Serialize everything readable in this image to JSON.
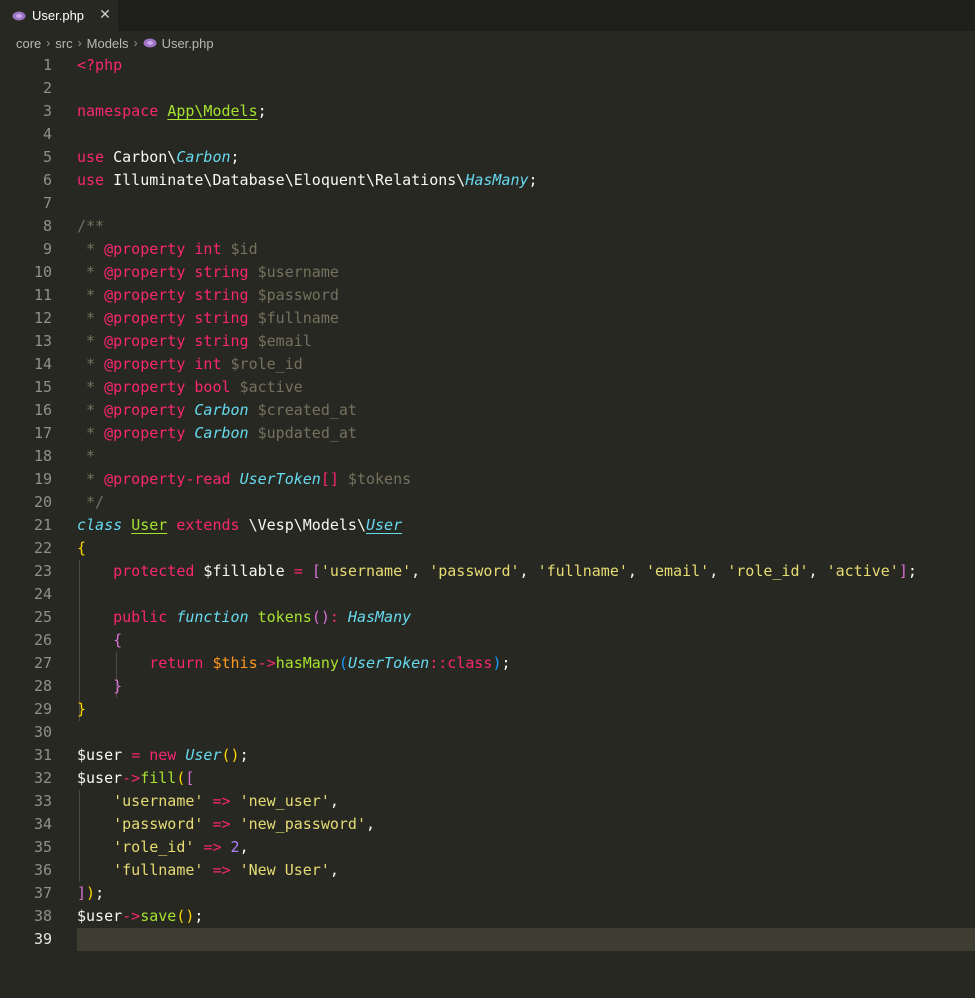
{
  "tab": {
    "label": "User.php",
    "close": "✕"
  },
  "breadcrumb": {
    "items": [
      "core",
      "src",
      "Models"
    ],
    "file": "User.php",
    "separator": "›"
  },
  "editor": {
    "active_line": 39,
    "lines": [
      {
        "n": "1",
        "tokens": [
          [
            "t-key",
            "<?php"
          ]
        ]
      },
      {
        "n": "2",
        "tokens": []
      },
      {
        "n": "3",
        "tokens": [
          [
            "t-key",
            "namespace"
          ],
          [
            "t-plain",
            " "
          ],
          [
            "t-ns",
            "App\\Models"
          ],
          [
            "t-plain",
            ";"
          ]
        ]
      },
      {
        "n": "4",
        "tokens": []
      },
      {
        "n": "5",
        "tokens": [
          [
            "t-key",
            "use"
          ],
          [
            "t-plain",
            " Carbon\\"
          ],
          [
            "t-type",
            "Carbon"
          ],
          [
            "t-plain",
            ";"
          ]
        ]
      },
      {
        "n": "6",
        "tokens": [
          [
            "t-key",
            "use"
          ],
          [
            "t-plain",
            " Illuminate\\Database\\Eloquent\\Relations\\"
          ],
          [
            "t-type",
            "HasMany"
          ],
          [
            "t-plain",
            ";"
          ]
        ]
      },
      {
        "n": "7",
        "tokens": []
      },
      {
        "n": "8",
        "tokens": [
          [
            "t-com",
            "/**"
          ]
        ]
      },
      {
        "n": "9",
        "tokens": [
          [
            "t-com",
            " * "
          ],
          [
            "t-tag",
            "@property"
          ],
          [
            "t-plain",
            " "
          ],
          [
            "t-key",
            "int"
          ],
          [
            "t-com",
            " $id"
          ]
        ]
      },
      {
        "n": "10",
        "tokens": [
          [
            "t-com",
            " * "
          ],
          [
            "t-tag",
            "@property"
          ],
          [
            "t-plain",
            " "
          ],
          [
            "t-key",
            "string"
          ],
          [
            "t-com",
            " $username"
          ]
        ]
      },
      {
        "n": "11",
        "tokens": [
          [
            "t-com",
            " * "
          ],
          [
            "t-tag",
            "@property"
          ],
          [
            "t-plain",
            " "
          ],
          [
            "t-key",
            "string"
          ],
          [
            "t-com",
            " $password"
          ]
        ]
      },
      {
        "n": "12",
        "tokens": [
          [
            "t-com",
            " * "
          ],
          [
            "t-tag",
            "@property"
          ],
          [
            "t-plain",
            " "
          ],
          [
            "t-key",
            "string"
          ],
          [
            "t-com",
            " $fullname"
          ]
        ]
      },
      {
        "n": "13",
        "tokens": [
          [
            "t-com",
            " * "
          ],
          [
            "t-tag",
            "@property"
          ],
          [
            "t-plain",
            " "
          ],
          [
            "t-key",
            "string"
          ],
          [
            "t-com",
            " $email"
          ]
        ]
      },
      {
        "n": "14",
        "tokens": [
          [
            "t-com",
            " * "
          ],
          [
            "t-tag",
            "@property"
          ],
          [
            "t-plain",
            " "
          ],
          [
            "t-key",
            "int"
          ],
          [
            "t-com",
            " $role_id"
          ]
        ]
      },
      {
        "n": "15",
        "tokens": [
          [
            "t-com",
            " * "
          ],
          [
            "t-tag",
            "@property"
          ],
          [
            "t-plain",
            " "
          ],
          [
            "t-key",
            "bool"
          ],
          [
            "t-com",
            " $active"
          ]
        ]
      },
      {
        "n": "16",
        "tokens": [
          [
            "t-com",
            " * "
          ],
          [
            "t-tag",
            "@property"
          ],
          [
            "t-plain",
            " "
          ],
          [
            "t-type",
            "Carbon"
          ],
          [
            "t-com",
            " $created_at"
          ]
        ]
      },
      {
        "n": "17",
        "tokens": [
          [
            "t-com",
            " * "
          ],
          [
            "t-tag",
            "@property"
          ],
          [
            "t-plain",
            " "
          ],
          [
            "t-type",
            "Carbon"
          ],
          [
            "t-com",
            " $updated_at"
          ]
        ]
      },
      {
        "n": "18",
        "tokens": [
          [
            "t-com",
            " *"
          ]
        ]
      },
      {
        "n": "19",
        "tokens": [
          [
            "t-com",
            " * "
          ],
          [
            "t-tag",
            "@property-read"
          ],
          [
            "t-plain",
            " "
          ],
          [
            "t-type",
            "UserToken"
          ],
          [
            "t-key",
            "[]"
          ],
          [
            "t-com",
            " $tokens"
          ]
        ]
      },
      {
        "n": "20",
        "tokens": [
          [
            "t-com",
            " */"
          ]
        ]
      },
      {
        "n": "21",
        "tokens": [
          [
            "t-type",
            "class"
          ],
          [
            "t-plain",
            " "
          ],
          [
            "t-cls",
            "User"
          ],
          [
            "t-plain",
            " "
          ],
          [
            "t-key",
            "extends"
          ],
          [
            "t-plain",
            " \\Vesp\\Models\\"
          ],
          [
            "t-typeu",
            "User"
          ]
        ]
      },
      {
        "n": "22",
        "tokens": [
          [
            "t-br1",
            "{"
          ]
        ]
      },
      {
        "n": "23",
        "tokens": [
          [
            "t-plain",
            "    "
          ],
          [
            "t-key",
            "protected"
          ],
          [
            "t-plain",
            " $fillable "
          ],
          [
            "t-op",
            "="
          ],
          [
            "t-plain",
            " "
          ],
          [
            "t-br2",
            "["
          ],
          [
            "t-str",
            "'username'"
          ],
          [
            "t-plain",
            ", "
          ],
          [
            "t-str",
            "'password'"
          ],
          [
            "t-plain",
            ", "
          ],
          [
            "t-str",
            "'fullname'"
          ],
          [
            "t-plain",
            ", "
          ],
          [
            "t-str",
            "'email'"
          ],
          [
            "t-plain",
            ", "
          ],
          [
            "t-str",
            "'role_id'"
          ],
          [
            "t-plain",
            ", "
          ],
          [
            "t-str",
            "'active'"
          ],
          [
            "t-br2",
            "]"
          ],
          [
            "t-plain",
            ";"
          ]
        ]
      },
      {
        "n": "24",
        "tokens": []
      },
      {
        "n": "25",
        "tokens": [
          [
            "t-plain",
            "    "
          ],
          [
            "t-key",
            "public"
          ],
          [
            "t-plain",
            " "
          ],
          [
            "t-type",
            "function"
          ],
          [
            "t-plain",
            " "
          ],
          [
            "t-fn",
            "tokens"
          ],
          [
            "t-br2",
            "()"
          ],
          [
            "t-op",
            ":"
          ],
          [
            "t-plain",
            " "
          ],
          [
            "t-type",
            "HasMany"
          ]
        ]
      },
      {
        "n": "26",
        "tokens": [
          [
            "t-plain",
            "    "
          ],
          [
            "t-br2",
            "{"
          ]
        ]
      },
      {
        "n": "27",
        "tokens": [
          [
            "t-plain",
            "        "
          ],
          [
            "t-key",
            "return"
          ],
          [
            "t-plain",
            " "
          ],
          [
            "t-this",
            "$this"
          ],
          [
            "t-op",
            "->"
          ],
          [
            "t-fn",
            "hasMany"
          ],
          [
            "t-br3",
            "("
          ],
          [
            "t-type",
            "UserToken"
          ],
          [
            "t-op",
            "::"
          ],
          [
            "t-key",
            "class"
          ],
          [
            "t-br3",
            ")"
          ],
          [
            "t-plain",
            ";"
          ]
        ]
      },
      {
        "n": "28",
        "tokens": [
          [
            "t-plain",
            "    "
          ],
          [
            "t-br2",
            "}"
          ]
        ]
      },
      {
        "n": "29",
        "tokens": [
          [
            "t-br1",
            "}"
          ]
        ]
      },
      {
        "n": "30",
        "tokens": []
      },
      {
        "n": "31",
        "tokens": [
          [
            "t-plain",
            "$user "
          ],
          [
            "t-op",
            "="
          ],
          [
            "t-plain",
            " "
          ],
          [
            "t-key",
            "new"
          ],
          [
            "t-plain",
            " "
          ],
          [
            "t-type",
            "User"
          ],
          [
            "t-br1",
            "()"
          ],
          [
            "t-plain",
            ";"
          ]
        ]
      },
      {
        "n": "32",
        "tokens": [
          [
            "t-plain",
            "$user"
          ],
          [
            "t-op",
            "->"
          ],
          [
            "t-fn",
            "fill"
          ],
          [
            "t-br1",
            "("
          ],
          [
            "t-br2",
            "["
          ]
        ]
      },
      {
        "n": "33",
        "tokens": [
          [
            "t-plain",
            "    "
          ],
          [
            "t-str",
            "'username'"
          ],
          [
            "t-plain",
            " "
          ],
          [
            "t-op",
            "=>"
          ],
          [
            "t-plain",
            " "
          ],
          [
            "t-str",
            "'new_user'"
          ],
          [
            "t-plain",
            ","
          ]
        ]
      },
      {
        "n": "34",
        "tokens": [
          [
            "t-plain",
            "    "
          ],
          [
            "t-str",
            "'password'"
          ],
          [
            "t-plain",
            " "
          ],
          [
            "t-op",
            "=>"
          ],
          [
            "t-plain",
            " "
          ],
          [
            "t-str",
            "'new_password'"
          ],
          [
            "t-plain",
            ","
          ]
        ]
      },
      {
        "n": "35",
        "tokens": [
          [
            "t-plain",
            "    "
          ],
          [
            "t-str",
            "'role_id'"
          ],
          [
            "t-plain",
            " "
          ],
          [
            "t-op",
            "=>"
          ],
          [
            "t-plain",
            " "
          ],
          [
            "t-num",
            "2"
          ],
          [
            "t-plain",
            ","
          ]
        ]
      },
      {
        "n": "36",
        "tokens": [
          [
            "t-plain",
            "    "
          ],
          [
            "t-str",
            "'fullname'"
          ],
          [
            "t-plain",
            " "
          ],
          [
            "t-op",
            "=>"
          ],
          [
            "t-plain",
            " "
          ],
          [
            "t-str",
            "'New User'"
          ],
          [
            "t-plain",
            ","
          ]
        ]
      },
      {
        "n": "37",
        "tokens": [
          [
            "t-br2",
            "]"
          ],
          [
            "t-br1",
            ")"
          ],
          [
            "t-plain",
            ";"
          ]
        ]
      },
      {
        "n": "38",
        "tokens": [
          [
            "t-plain",
            "$user"
          ],
          [
            "t-op",
            "->"
          ],
          [
            "t-fn",
            "save"
          ],
          [
            "t-br1",
            "()"
          ],
          [
            "t-plain",
            ";"
          ]
        ]
      },
      {
        "n": "39",
        "tokens": []
      }
    ]
  }
}
